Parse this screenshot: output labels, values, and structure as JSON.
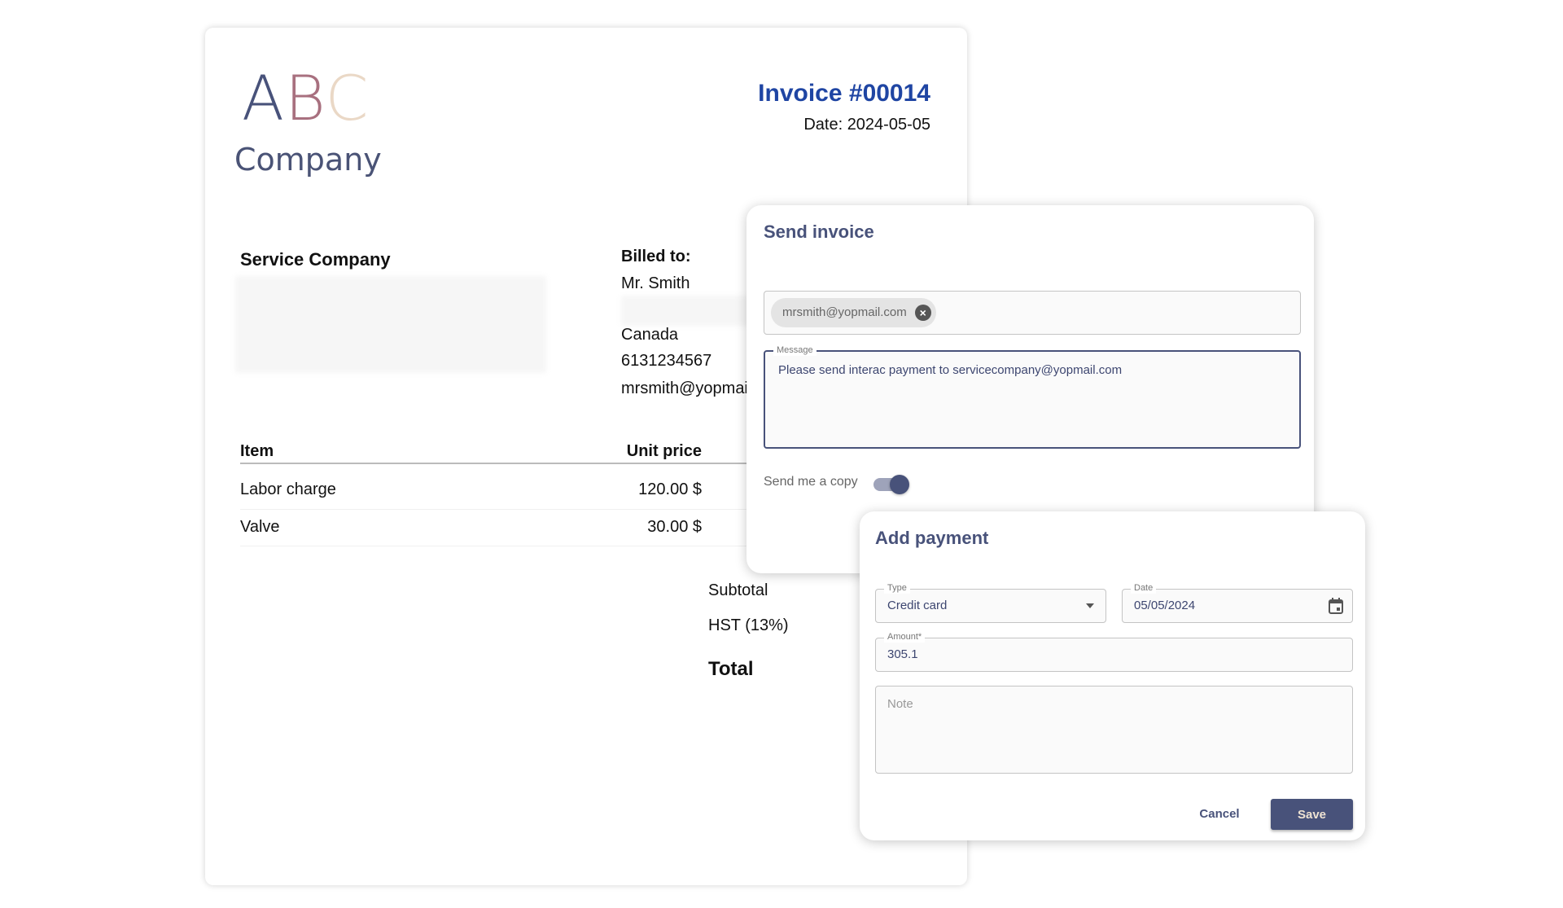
{
  "logo": {
    "letters": [
      "A",
      "B",
      "C"
    ],
    "colors": [
      "#48527a",
      "#a8707f",
      "#ead8c6"
    ],
    "subtitle": "Company"
  },
  "invoice": {
    "title": "Invoice #00014",
    "date": "Date: 2024-05-05",
    "from_name": "Service Company",
    "billed_to_label": "Billed to:",
    "billed_to": {
      "name": "Mr. Smith",
      "country": "Canada",
      "phone": "6131234567",
      "email": "mrsmith@yopmai"
    },
    "table": {
      "headers": [
        "Item",
        "Unit price"
      ],
      "rows": [
        [
          "Labor charge",
          "120.00 $"
        ],
        [
          "Valve",
          "30.00 $"
        ]
      ]
    },
    "totals": {
      "subtotal_label": "Subtotal",
      "tax_label": "HST (13%)",
      "total_label": "Total"
    }
  },
  "send_dialog": {
    "title": "Send invoice",
    "recipient_chip": "mrsmith@yopmail.com",
    "message_label": "Message",
    "message_value": "Please send interac payment to servicecompany@yopmail.com",
    "copy_label": "Send me a copy",
    "copy_on": true
  },
  "payment_dialog": {
    "title": "Add payment",
    "type_label": "Type",
    "type_value": "Credit card",
    "date_label": "Date",
    "date_value": "05/05/2024",
    "amount_label": "Amount*",
    "amount_value": "305.1",
    "note_placeholder": "Note",
    "cancel_label": "Cancel",
    "save_label": "Save"
  },
  "colors": {
    "accent": "#48527a",
    "invoice_title": "#1f45a3"
  }
}
